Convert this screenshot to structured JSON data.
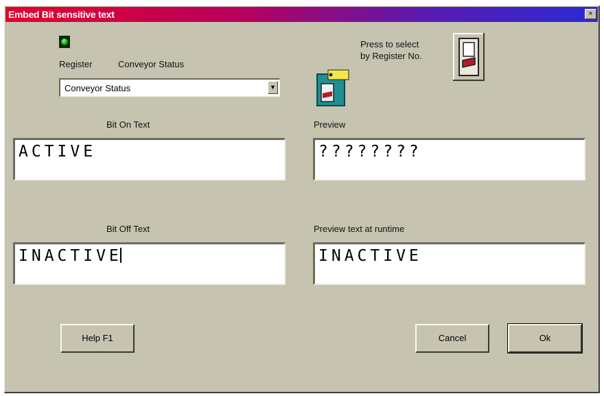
{
  "window": {
    "title": "Embed Bit sensitive text",
    "close_glyph": "×"
  },
  "register": {
    "label": "Register",
    "status_label": "Conveyor Status",
    "led_color": "#0aa20a"
  },
  "combo": {
    "value": "Conveyor Status",
    "arrow": "▼"
  },
  "select_by_register": {
    "line1": "Press to select",
    "line2": "by Register No."
  },
  "bit_on": {
    "label": "Bit On Text",
    "value": "ACTIVE"
  },
  "preview": {
    "label": "Preview",
    "value": "????????"
  },
  "bit_off": {
    "label": "Bit Off Text",
    "value": "INACTIVE"
  },
  "preview_runtime": {
    "label": "Preview text at runtime",
    "value": "INACTIVE"
  },
  "buttons": {
    "help": "Help  F1",
    "cancel": "Cancel",
    "ok": "Ok"
  },
  "icons": {
    "register_icon": "register-panel-icon",
    "tag_icon": "tag-panel-icon"
  }
}
